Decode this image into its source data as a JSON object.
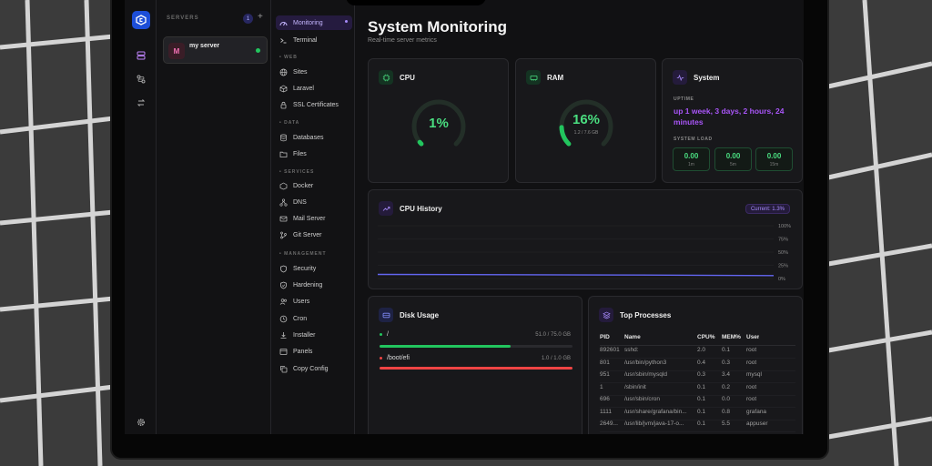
{
  "page": {
    "title": "System Monitoring",
    "subtitle": "Real-time server metrics"
  },
  "servers": {
    "header": "SERVERS",
    "count": "1",
    "add": "+",
    "items": [
      {
        "initial": "M",
        "name": "my server",
        "status_color": "#22c55e"
      }
    ]
  },
  "nav": {
    "top": [
      {
        "label": "Monitoring",
        "icon": "gauge-icon",
        "active": true
      },
      {
        "label": "Terminal",
        "icon": "terminal-icon"
      }
    ],
    "sections": [
      {
        "title": "• WEB",
        "items": [
          {
            "label": "Sites",
            "icon": "globe-icon"
          },
          {
            "label": "Laravel",
            "icon": "cube-icon"
          },
          {
            "label": "SSL Certificates",
            "icon": "lock-icon"
          }
        ]
      },
      {
        "title": "• DATA",
        "items": [
          {
            "label": "Databases",
            "icon": "database-icon"
          },
          {
            "label": "Files",
            "icon": "folder-icon"
          }
        ]
      },
      {
        "title": "• SERVICES",
        "items": [
          {
            "label": "Docker",
            "icon": "box-icon"
          },
          {
            "label": "DNS",
            "icon": "network-icon"
          },
          {
            "label": "Mail Server",
            "icon": "mail-icon"
          },
          {
            "label": "Git Server",
            "icon": "git-icon"
          }
        ]
      },
      {
        "title": "• MANAGEMENT",
        "items": [
          {
            "label": "Security",
            "icon": "shield-icon"
          },
          {
            "label": "Hardening",
            "icon": "shield-check-icon"
          },
          {
            "label": "Users",
            "icon": "users-icon"
          },
          {
            "label": "Cron",
            "icon": "clock-icon"
          },
          {
            "label": "Installer",
            "icon": "download-icon"
          },
          {
            "label": "Panels",
            "icon": "panel-icon"
          },
          {
            "label": "Copy Config",
            "icon": "copy-icon"
          }
        ]
      }
    ]
  },
  "cpu": {
    "title": "CPU",
    "value": "1%",
    "percent": 1
  },
  "ram": {
    "title": "RAM",
    "value": "16%",
    "detail": "1.2 / 7.6 GB",
    "percent": 16
  },
  "system": {
    "title": "System",
    "uptime_label": "UPTIME",
    "uptime": "up 1 week, 3 days, 2 hours, 24 minutes",
    "load_label": "SYSTEM LOAD",
    "loads": [
      {
        "value": "0.00",
        "label": "1m"
      },
      {
        "value": "0.00",
        "label": "5m"
      },
      {
        "value": "0.00",
        "label": "15m"
      }
    ]
  },
  "history": {
    "title": "CPU History",
    "current": "Current: 1.3%",
    "ticks": [
      "100%",
      "75%",
      "50%",
      "25%",
      "0%"
    ]
  },
  "disk": {
    "title": "Disk Usage",
    "items": [
      {
        "mount": "/",
        "usage": "51.0 / 75.0 GB",
        "fraction": 0.68,
        "color": "#22c55e"
      },
      {
        "mount": "/boot/efi",
        "usage": "1.0 / 1.0 GB",
        "fraction": 1.0,
        "color": "#ef4444"
      }
    ]
  },
  "processes": {
    "title": "Top Processes",
    "headers": [
      "PID",
      "Name",
      "CPU%",
      "MEM%",
      "User"
    ],
    "rows": [
      [
        "892601",
        "sshd:",
        "2.0",
        "0.1",
        "root"
      ],
      [
        "801",
        "/usr/bin/python3",
        "0.4",
        "0.3",
        "root"
      ],
      [
        "951",
        "/usr/sbin/mysqld",
        "0.3",
        "3.4",
        "mysql"
      ],
      [
        "1",
        "/sbin/init",
        "0.1",
        "0.2",
        "root"
      ],
      [
        "696",
        "/usr/sbin/cron",
        "0.1",
        "0.0",
        "root"
      ],
      [
        "1111",
        "/usr/share/grafana/bin...",
        "0.1",
        "0.8",
        "grafana"
      ],
      [
        "2649...",
        "/usr/lib/jvm/java-17-o...",
        "0.1",
        "5.5",
        "appuser"
      ]
    ]
  },
  "colors": {
    "accent": "#8b5cf6",
    "green": "#22c55e",
    "red": "#ef4444"
  }
}
